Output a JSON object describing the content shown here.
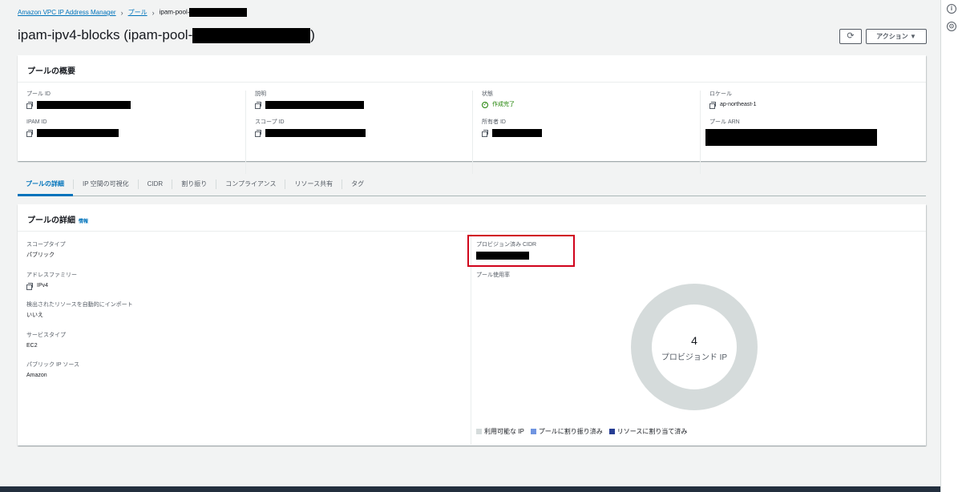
{
  "breadcrumb": {
    "root": "Amazon VPC IP Address Manager",
    "pools": "プール",
    "current": "ipam-pool-"
  },
  "page": {
    "title": "ipam-ipv4-blocks (ipam-pool-",
    "title_close": ")"
  },
  "actions": {
    "refresh_icon": "⟳",
    "action_label": "アクション ▼"
  },
  "overview": {
    "title": "プールの概要",
    "pool_id_label": "プール ID",
    "ipam_id_label": "IPAM ID",
    "description_label": "説明",
    "scope_id_label": "スコープ ID",
    "state_label": "状態",
    "state_value": "作成完了",
    "owner_id_label": "所有者 ID",
    "locale_label": "ロケール",
    "locale_value": "ap-northeast-1",
    "pool_arn_label": "プール ARN"
  },
  "tabs": [
    {
      "label": "プールの詳細"
    },
    {
      "label": "IP 空間の可視化"
    },
    {
      "label": "CIDR"
    },
    {
      "label": "割り振り"
    },
    {
      "label": "コンプライアンス"
    },
    {
      "label": "リソース共有"
    },
    {
      "label": "タグ"
    }
  ],
  "details": {
    "title": "プールの詳細",
    "info_link": "情報",
    "scope_type_label": "スコープタイプ",
    "scope_type_value": "パブリック",
    "address_family_label": "アドレスファミリー",
    "address_family_value": "IPv4",
    "auto_import_label": "検出されたリソースを自動的にインポート",
    "auto_import_value": "いいえ",
    "service_type_label": "サービスタイプ",
    "service_type_value": "EC2",
    "public_ip_source_label": "パブリック IP ソース",
    "public_ip_source_value": "Amazon",
    "provisioned_cidr_label": "プロビジョン済み CIDR",
    "pool_usage_label": "プール使用率"
  },
  "chart_data": {
    "type": "pie",
    "center_value": "4",
    "center_label": "プロビジョンド IP",
    "legend": [
      {
        "label": "利用可能な IP",
        "color": "#d5dbdb"
      },
      {
        "label": "プールに割り振り済み",
        "color": "#7095e1"
      },
      {
        "label": "リソースに割り当て済み",
        "color": "#273e94"
      }
    ],
    "values": [
      4,
      0,
      0
    ]
  },
  "colors": {
    "link": "#0073bb",
    "success": "#1d8102",
    "highlight": "#d0021b"
  }
}
